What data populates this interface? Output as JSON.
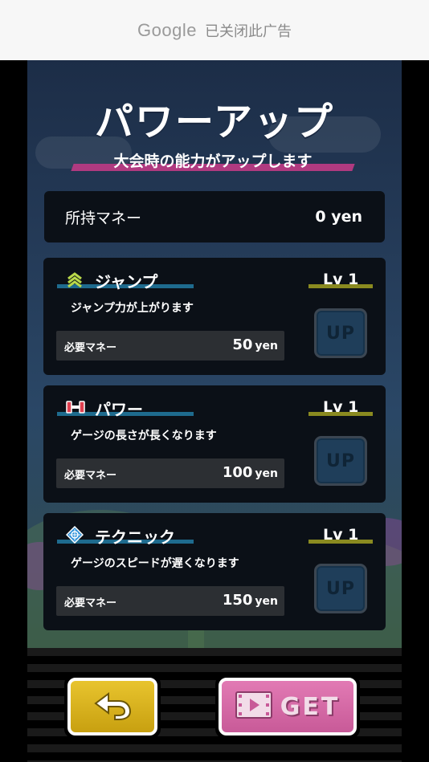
{
  "ad_bar": {
    "brand": "Google",
    "text": "已关闭此广告"
  },
  "header": {
    "title": "パワーアップ",
    "subtitle": "大会時の能力がアップします"
  },
  "money": {
    "label": "所持マネー",
    "value": "0 yen"
  },
  "upgrades": [
    {
      "icon": "jump-chevrons-icon",
      "name": "ジャンプ",
      "level": "Lv 1",
      "description": "ジャンプ力が上がります",
      "cost_label": "必要マネー",
      "cost": "50",
      "unit": "yen",
      "button": "UP"
    },
    {
      "icon": "power-dumbbell-icon",
      "name": "パワー",
      "level": "Lv 1",
      "description": "ゲージの長さが長くなります",
      "cost_label": "必要マネー",
      "cost": "100",
      "unit": "yen",
      "button": "UP"
    },
    {
      "icon": "technique-crosshair-icon",
      "name": "テクニック",
      "level": "Lv 1",
      "description": "ゲージのスピードが遅くなります",
      "cost_label": "必要マネー",
      "cost": "150",
      "unit": "yen",
      "button": "UP"
    }
  ],
  "footer": {
    "back_icon": "return-arrow-icon",
    "get_icon": "film-icon",
    "get_label": "GET"
  },
  "colors": {
    "card": "#0b1017",
    "name_underline": "#1e6b8e",
    "level_underline": "#8a8a20",
    "subtitle_band": "#b03a80",
    "back_button": "#e0b820",
    "get_button": "#d86aa8"
  }
}
